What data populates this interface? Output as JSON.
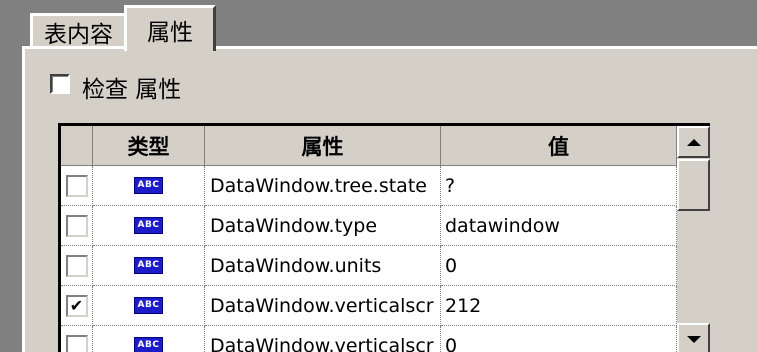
{
  "tabs": [
    {
      "label": "表内容",
      "selected": false
    },
    {
      "label": "属性",
      "selected": true
    }
  ],
  "check_properties": {
    "label": "检查 属性",
    "checked": false
  },
  "grid": {
    "columns": {
      "type": "类型",
      "attribute": "属性",
      "value": "值"
    },
    "rows": [
      {
        "checked": false,
        "type_icon": "abc-string-icon",
        "type_text": "ABC",
        "attribute": "DataWindow.tree.state",
        "value": "?"
      },
      {
        "checked": false,
        "type_icon": "abc-string-icon",
        "type_text": "ABC",
        "attribute": "DataWindow.type",
        "value": "datawindow"
      },
      {
        "checked": false,
        "type_icon": "abc-string-icon",
        "type_text": "ABC",
        "attribute": "DataWindow.units",
        "value": "0"
      },
      {
        "checked": true,
        "type_icon": "abc-string-icon",
        "type_text": "ABC",
        "attribute": "DataWindow.verticalscr",
        "value": "212"
      },
      {
        "checked": false,
        "type_icon": "abc-string-icon",
        "type_text": "ABC",
        "attribute": "DataWindow.verticalscr",
        "value": "0"
      }
    ]
  },
  "scrollbar": {
    "up_icon": "scroll-up-arrow-icon",
    "down_icon": "scroll-down-arrow-icon"
  },
  "colors": {
    "panel": "#d4d0c8",
    "background": "#808080",
    "type_badge": "#1c1cc8"
  }
}
